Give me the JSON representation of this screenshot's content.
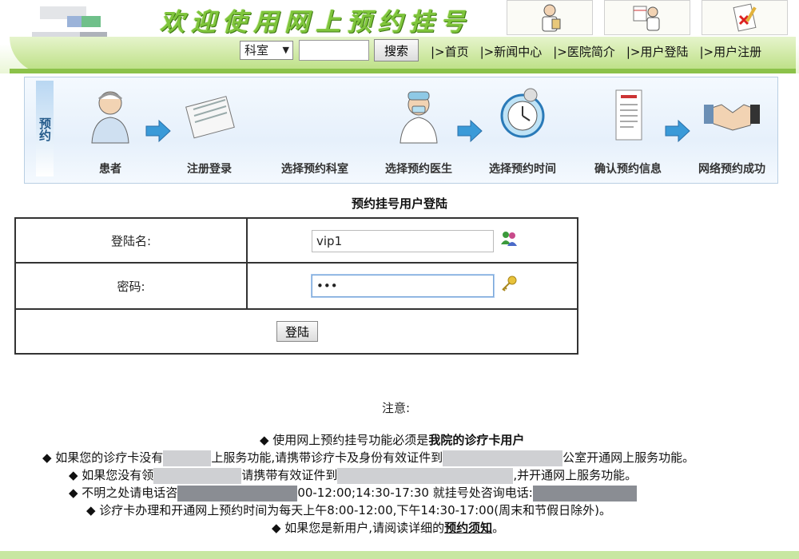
{
  "header": {
    "title": "欢迎使用网上预约挂号",
    "department_select": "科室",
    "search_placeholder": "",
    "search_button": "搜索",
    "nav_links": [
      "|>首页",
      "|>新闻中心",
      "|>医院简介",
      "|>用户登陆",
      "|>用户注册"
    ]
  },
  "steps": {
    "tag": "预约",
    "items": [
      "患者",
      "注册登录",
      "选择预约科室",
      "选择预约医生",
      "选择预约时间",
      "确认预约信息",
      "网络预约成功"
    ]
  },
  "login": {
    "title": "预约挂号用户登陆",
    "username_label": "登陆名:",
    "username_value": "vip1",
    "password_label": "密码:",
    "password_value": "•••",
    "submit": "登陆"
  },
  "notice": {
    "title": "注意:",
    "line1_pre": "◆ 使用网上预约挂号功能必须是",
    "line1_bold": "我院的诊疗卡用户",
    "line2_a": "◆ 如果您的诊疗卡没有",
    "line2_b": "上服务功能,请携带诊疗卡及身份有效证件到",
    "line2_c": "公室开通网上服务功能。",
    "line3_a": "◆ 如果您没有领",
    "line3_b": "请携带有效证件到",
    "line3_c": ",并开通网上服务功能。",
    "line4_a": "◆ 不明之处请电话咨",
    "line4_b": "00-12:00;14:30-17:30 就挂号处咨询电话:",
    "line5": "◆ 诊疗卡办理和开通网上预约时间为每天上午8:00-12:00,下午14:30-17:00(周末和节假日除外)。",
    "line6_pre": "◆ 如果您是新用户,请阅读详细的",
    "line6_link": "预约须知",
    "line6_post": "。"
  },
  "colors": {
    "brand_green": "#7fc53c",
    "nav_green": "#b9de7f",
    "banner_blue": "#e6f0fb"
  }
}
